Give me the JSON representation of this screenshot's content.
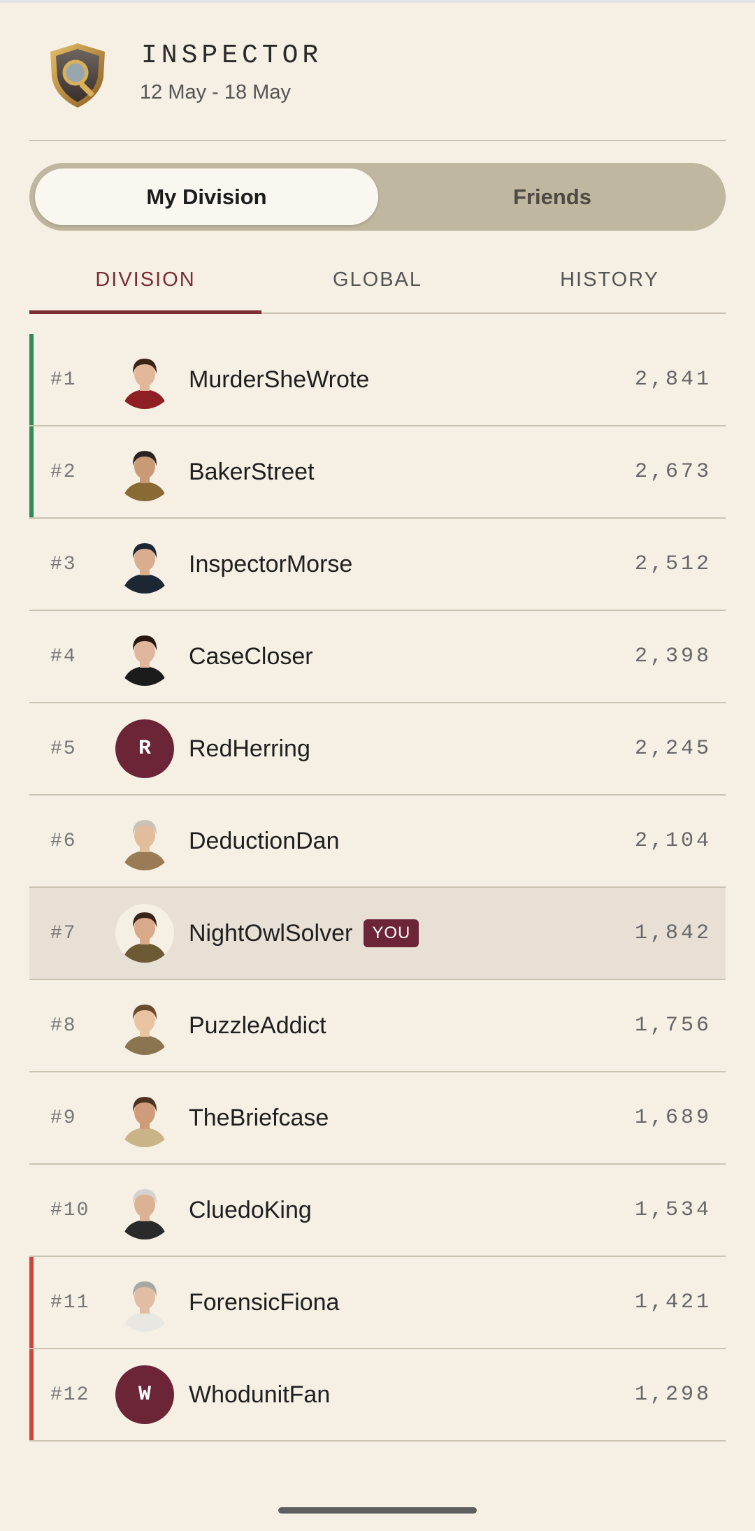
{
  "header": {
    "title": "INSPECTOR",
    "dates": "12 May - 18 May",
    "badge_icon": "inspector-shield-magnifier-icon"
  },
  "segments": {
    "active": "My Division",
    "inactive": "Friends"
  },
  "tabs": [
    {
      "label": "DIVISION",
      "active": true
    },
    {
      "label": "GLOBAL",
      "active": false
    },
    {
      "label": "HISTORY",
      "active": false
    }
  ],
  "colors": {
    "promotion": "#2e8b57",
    "relegation": "#c9463d",
    "accent": "#7a2d33",
    "you_badge": "#6b2536"
  },
  "you_label": "YOU",
  "leaderboard": [
    {
      "rank": "#1",
      "name": "MurderSheWrote",
      "score": "2,841",
      "zone": "promotion",
      "avatar": "woman-red-dress"
    },
    {
      "rank": "#2",
      "name": "BakerStreet",
      "score": "2,673",
      "zone": "promotion",
      "avatar": "detective-fedora"
    },
    {
      "rank": "#3",
      "name": "InspectorMorse",
      "score": "2,512",
      "zone": "",
      "avatar": "policeman"
    },
    {
      "rank": "#4",
      "name": "CaseCloser",
      "score": "2,398",
      "zone": "",
      "avatar": "woman-black-dress"
    },
    {
      "rank": "#5",
      "name": "RedHerring",
      "score": "2,245",
      "zone": "",
      "avatar": "",
      "initial": "R"
    },
    {
      "rank": "#6",
      "name": "DeductionDan",
      "score": "2,104",
      "zone": "",
      "avatar": "old-man-glasses"
    },
    {
      "rank": "#7",
      "name": "NightOwlSolver",
      "score": "1,842",
      "zone": "",
      "avatar": "woman-trenchcoat",
      "is_you": true
    },
    {
      "rank": "#8",
      "name": "PuzzleAddict",
      "score": "1,756",
      "zone": "",
      "avatar": "boy-magnifier"
    },
    {
      "rank": "#9",
      "name": "TheBriefcase",
      "score": "1,689",
      "zone": "",
      "avatar": "man-pipe"
    },
    {
      "rank": "#10",
      "name": "CluedoKing",
      "score": "1,534",
      "zone": "",
      "avatar": "bearded-old-man"
    },
    {
      "rank": "#11",
      "name": "ForensicFiona",
      "score": "1,421",
      "zone": "relegation",
      "avatar": "woman-lab-coat"
    },
    {
      "rank": "#12",
      "name": "WhodunitFan",
      "score": "1,298",
      "zone": "relegation",
      "avatar": "",
      "initial": "W"
    }
  ]
}
